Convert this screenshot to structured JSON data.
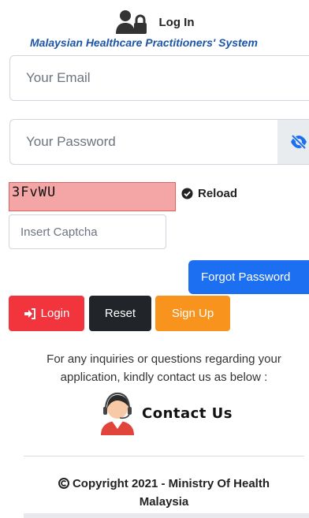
{
  "header": {
    "title": "Log In",
    "system_name": "Malaysian Healthcare Practitioners' System",
    "icon": "user-lock-icon"
  },
  "form": {
    "email_placeholder": "Your Email",
    "password_placeholder": "Your Password",
    "password_toggle_icon": "eye-slash-icon",
    "captcha_text": "3FvWU",
    "captcha_reload_label": "Reload",
    "captcha_reload_icon": "check-circle-icon",
    "captcha_placeholder": "Insert Captcha"
  },
  "buttons": {
    "forgot_password": "Forgot Password",
    "login": "Login",
    "login_icon": "sign-in-icon",
    "reset": "Reset",
    "sign_up": "Sign Up"
  },
  "inquiry": {
    "line1": "For any inquiries or questions regarding your",
    "line2": "application, kindly contact us as below :"
  },
  "contact": {
    "label": "Contact Us",
    "icon": "support-agent-icon"
  },
  "footer": {
    "line1": "Copyright 2021 - Ministry Of Health",
    "line2": "Malaysia",
    "icon": "copyright-icon"
  },
  "colors": {
    "login": "#f2343d",
    "reset": "#212529",
    "signup": "#f8941d",
    "forgot": "#1d6ff2",
    "system_name": "#1c55a6",
    "captcha_bg": "#f4a5a5"
  }
}
